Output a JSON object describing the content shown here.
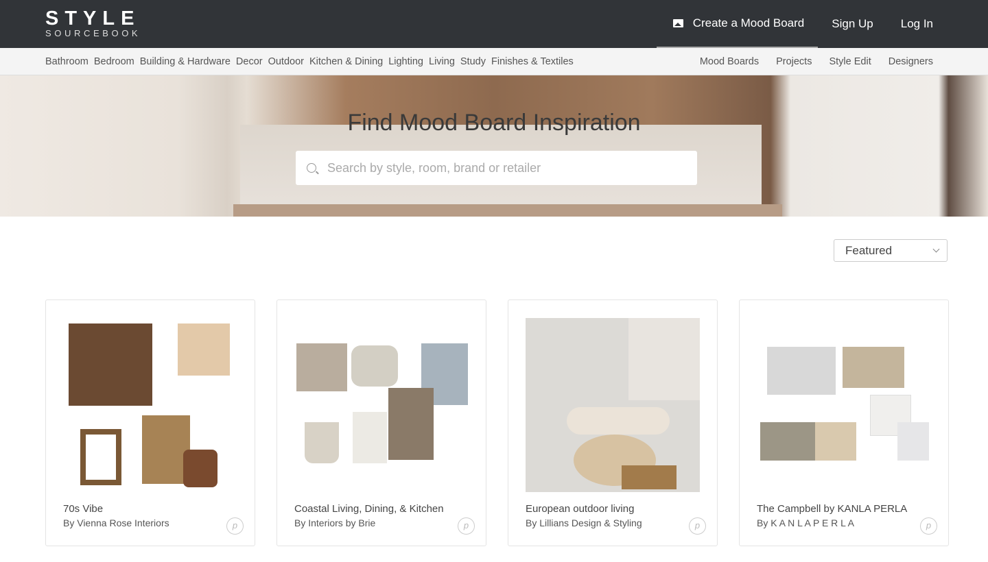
{
  "brand": {
    "line1": "STYLE",
    "line2": "SOURCEBOOK"
  },
  "topnav": {
    "create": "Create a Mood Board",
    "signup": "Sign Up",
    "login": "Log In"
  },
  "categories": [
    "Bathroom",
    "Bedroom",
    "Building & Hardware",
    "Decor",
    "Outdoor",
    "Kitchen & Dining",
    "Lighting",
    "Living",
    "Study",
    "Finishes & Textiles"
  ],
  "sections": [
    "Mood Boards",
    "Projects",
    "Style Edit",
    "Designers"
  ],
  "hero": {
    "title": "Find Mood Board Inspiration",
    "search_placeholder": "Search by style, room, brand or retailer"
  },
  "sort": {
    "selected": "Featured"
  },
  "cards": [
    {
      "title": "70s Vibe",
      "by": "By Vienna Rose Interiors"
    },
    {
      "title": "Coastal Living, Dining, & Kitchen",
      "by": "By Interiors by Brie"
    },
    {
      "title": "European outdoor living",
      "by": "By Lillians Design & Styling"
    },
    {
      "title": "The Campbell by KANLA PERLA",
      "by": "By K A N L A P E R L A"
    }
  ]
}
